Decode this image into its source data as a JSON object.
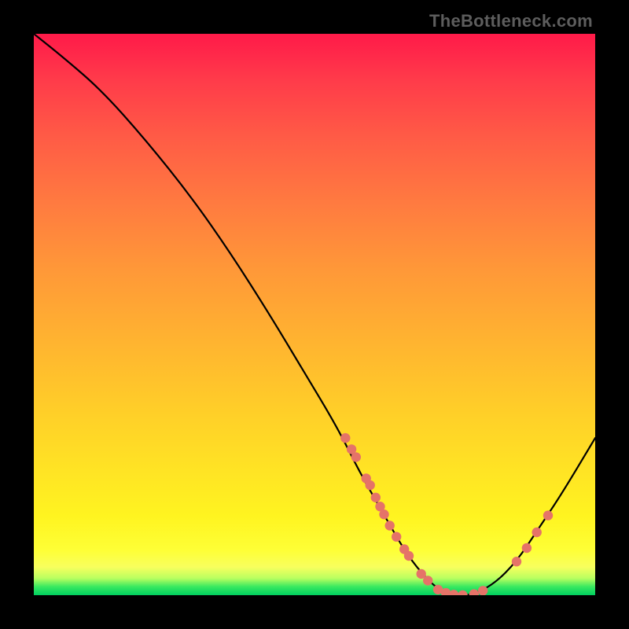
{
  "watermark": "TheBottleneck.com",
  "colors": {
    "curve_stroke": "#000000",
    "dot_fill": "#e57368",
    "gradient_top": "#ff1a49",
    "gradient_bottom": "#00d060"
  },
  "chart_data": {
    "type": "line",
    "title": "",
    "xlabel": "",
    "ylabel": "",
    "xlim": [
      0,
      100
    ],
    "ylim": [
      0,
      100
    ],
    "grid": false,
    "legend": false,
    "series": [
      {
        "name": "bottleneck-curve",
        "x": [
          0,
          5,
          12,
          20,
          28,
          35,
          42,
          48,
          54,
          58,
          62,
          66,
          69,
          72,
          75,
          78,
          82,
          86,
          90,
          94,
          100
        ],
        "values": [
          100,
          96,
          90,
          81,
          71,
          61,
          50,
          40,
          30,
          22,
          15,
          8,
          4,
          1,
          0,
          0,
          2,
          6,
          12,
          18,
          28
        ]
      }
    ],
    "curve_dots": [
      {
        "x": 55.5,
        "y": 28.0
      },
      {
        "x": 56.6,
        "y": 26.0
      },
      {
        "x": 57.4,
        "y": 24.6
      },
      {
        "x": 59.2,
        "y": 20.8
      },
      {
        "x": 59.9,
        "y": 19.6
      },
      {
        "x": 60.9,
        "y": 17.4
      },
      {
        "x": 61.7,
        "y": 15.8
      },
      {
        "x": 62.4,
        "y": 14.4
      },
      {
        "x": 63.4,
        "y": 12.4
      },
      {
        "x": 64.6,
        "y": 10.4
      },
      {
        "x": 66.0,
        "y": 8.2
      },
      {
        "x": 66.8,
        "y": 7.0
      },
      {
        "x": 69.0,
        "y": 3.8
      },
      {
        "x": 70.2,
        "y": 2.6
      },
      {
        "x": 72.0,
        "y": 1.0
      },
      {
        "x": 73.4,
        "y": 0.4
      },
      {
        "x": 74.8,
        "y": 0.1
      },
      {
        "x": 76.4,
        "y": 0.0
      },
      {
        "x": 78.4,
        "y": 0.2
      },
      {
        "x": 80.0,
        "y": 0.8
      },
      {
        "x": 86.0,
        "y": 6.0
      },
      {
        "x": 87.8,
        "y": 8.4
      },
      {
        "x": 89.6,
        "y": 11.2
      },
      {
        "x": 91.6,
        "y": 14.2
      }
    ]
  }
}
